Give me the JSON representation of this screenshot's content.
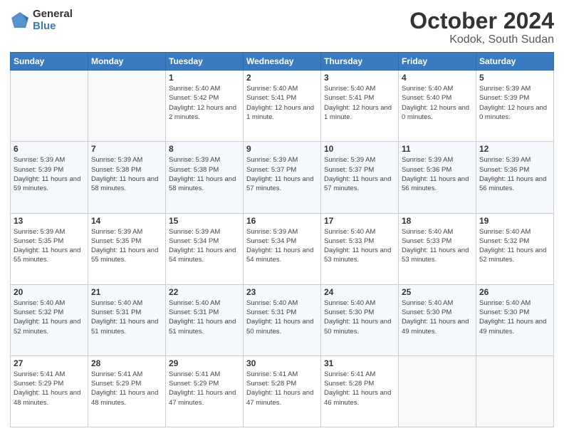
{
  "logo": {
    "general": "General",
    "blue": "Blue"
  },
  "header": {
    "title": "October 2024",
    "subtitle": "Kodok, South Sudan"
  },
  "days_of_week": [
    "Sunday",
    "Monday",
    "Tuesday",
    "Wednesday",
    "Thursday",
    "Friday",
    "Saturday"
  ],
  "weeks": [
    [
      {
        "day": "",
        "info": ""
      },
      {
        "day": "",
        "info": ""
      },
      {
        "day": "1",
        "info": "Sunrise: 5:40 AM\nSunset: 5:42 PM\nDaylight: 12 hours\nand 2 minutes."
      },
      {
        "day": "2",
        "info": "Sunrise: 5:40 AM\nSunset: 5:41 PM\nDaylight: 12 hours\nand 1 minute."
      },
      {
        "day": "3",
        "info": "Sunrise: 5:40 AM\nSunset: 5:41 PM\nDaylight: 12 hours\nand 1 minute."
      },
      {
        "day": "4",
        "info": "Sunrise: 5:40 AM\nSunset: 5:40 PM\nDaylight: 12 hours\nand 0 minutes."
      },
      {
        "day": "5",
        "info": "Sunrise: 5:39 AM\nSunset: 5:39 PM\nDaylight: 12 hours\nand 0 minutes."
      }
    ],
    [
      {
        "day": "6",
        "info": "Sunrise: 5:39 AM\nSunset: 5:39 PM\nDaylight: 11 hours\nand 59 minutes."
      },
      {
        "day": "7",
        "info": "Sunrise: 5:39 AM\nSunset: 5:38 PM\nDaylight: 11 hours\nand 58 minutes."
      },
      {
        "day": "8",
        "info": "Sunrise: 5:39 AM\nSunset: 5:38 PM\nDaylight: 11 hours\nand 58 minutes."
      },
      {
        "day": "9",
        "info": "Sunrise: 5:39 AM\nSunset: 5:37 PM\nDaylight: 11 hours\nand 57 minutes."
      },
      {
        "day": "10",
        "info": "Sunrise: 5:39 AM\nSunset: 5:37 PM\nDaylight: 11 hours\nand 57 minutes."
      },
      {
        "day": "11",
        "info": "Sunrise: 5:39 AM\nSunset: 5:36 PM\nDaylight: 11 hours\nand 56 minutes."
      },
      {
        "day": "12",
        "info": "Sunrise: 5:39 AM\nSunset: 5:36 PM\nDaylight: 11 hours\nand 56 minutes."
      }
    ],
    [
      {
        "day": "13",
        "info": "Sunrise: 5:39 AM\nSunset: 5:35 PM\nDaylight: 11 hours\nand 55 minutes."
      },
      {
        "day": "14",
        "info": "Sunrise: 5:39 AM\nSunset: 5:35 PM\nDaylight: 11 hours\nand 55 minutes."
      },
      {
        "day": "15",
        "info": "Sunrise: 5:39 AM\nSunset: 5:34 PM\nDaylight: 11 hours\nand 54 minutes."
      },
      {
        "day": "16",
        "info": "Sunrise: 5:39 AM\nSunset: 5:34 PM\nDaylight: 11 hours\nand 54 minutes."
      },
      {
        "day": "17",
        "info": "Sunrise: 5:40 AM\nSunset: 5:33 PM\nDaylight: 11 hours\nand 53 minutes."
      },
      {
        "day": "18",
        "info": "Sunrise: 5:40 AM\nSunset: 5:33 PM\nDaylight: 11 hours\nand 53 minutes."
      },
      {
        "day": "19",
        "info": "Sunrise: 5:40 AM\nSunset: 5:32 PM\nDaylight: 11 hours\nand 52 minutes."
      }
    ],
    [
      {
        "day": "20",
        "info": "Sunrise: 5:40 AM\nSunset: 5:32 PM\nDaylight: 11 hours\nand 52 minutes."
      },
      {
        "day": "21",
        "info": "Sunrise: 5:40 AM\nSunset: 5:31 PM\nDaylight: 11 hours\nand 51 minutes."
      },
      {
        "day": "22",
        "info": "Sunrise: 5:40 AM\nSunset: 5:31 PM\nDaylight: 11 hours\nand 51 minutes."
      },
      {
        "day": "23",
        "info": "Sunrise: 5:40 AM\nSunset: 5:31 PM\nDaylight: 11 hours\nand 50 minutes."
      },
      {
        "day": "24",
        "info": "Sunrise: 5:40 AM\nSunset: 5:30 PM\nDaylight: 11 hours\nand 50 minutes."
      },
      {
        "day": "25",
        "info": "Sunrise: 5:40 AM\nSunset: 5:30 PM\nDaylight: 11 hours\nand 49 minutes."
      },
      {
        "day": "26",
        "info": "Sunrise: 5:40 AM\nSunset: 5:30 PM\nDaylight: 11 hours\nand 49 minutes."
      }
    ],
    [
      {
        "day": "27",
        "info": "Sunrise: 5:41 AM\nSunset: 5:29 PM\nDaylight: 11 hours\nand 48 minutes."
      },
      {
        "day": "28",
        "info": "Sunrise: 5:41 AM\nSunset: 5:29 PM\nDaylight: 11 hours\nand 48 minutes."
      },
      {
        "day": "29",
        "info": "Sunrise: 5:41 AM\nSunset: 5:29 PM\nDaylight: 11 hours\nand 47 minutes."
      },
      {
        "day": "30",
        "info": "Sunrise: 5:41 AM\nSunset: 5:28 PM\nDaylight: 11 hours\nand 47 minutes."
      },
      {
        "day": "31",
        "info": "Sunrise: 5:41 AM\nSunset: 5:28 PM\nDaylight: 11 hours\nand 46 minutes."
      },
      {
        "day": "",
        "info": ""
      },
      {
        "day": "",
        "info": ""
      }
    ]
  ]
}
